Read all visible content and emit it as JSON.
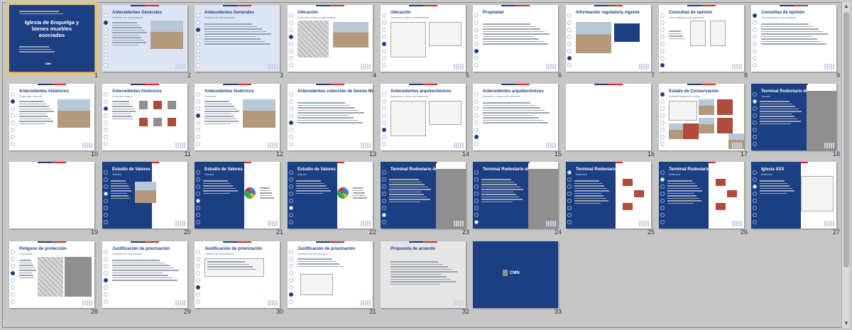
{
  "window": {
    "name": "slide-sorter"
  },
  "slides": [
    {
      "n": "1",
      "kind": "cover",
      "title": "Iglesia de Enquelga y bienes muebles asociados",
      "logo": "CMN"
    },
    {
      "n": "2",
      "kind": "text-photo",
      "title": "Antecedentes Generales",
      "sub": "Solicitud de declaratoria",
      "bg": "light-blue"
    },
    {
      "n": "3",
      "kind": "text",
      "title": "Antecedentes Generales",
      "sub": "Solicitud de declaratoria",
      "bg": "light-blue"
    },
    {
      "n": "4",
      "kind": "map",
      "title": "Ubicación",
      "sub": "Contexto urbano y patrimonial"
    },
    {
      "n": "5",
      "kind": "plans",
      "title": "Ubicación",
      "sub": "Contexto urbano y patrimonial"
    },
    {
      "n": "6",
      "kind": "text",
      "title": "Propiedad",
      "sub": ""
    },
    {
      "n": "7",
      "kind": "photo-panel",
      "title": "Información regulatoria vigente",
      "sub": ""
    },
    {
      "n": "8",
      "kind": "docs",
      "title": "Consultas de opinión",
      "sub": "Comunidades y propietarios"
    },
    {
      "n": "9",
      "kind": "text",
      "title": "Consultas de opinión",
      "sub": "Comunidades y propietarios"
    },
    {
      "n": "10",
      "kind": "text-photo",
      "title": "Antecedentes históricos",
      "sub": "Enquelga, historia"
    },
    {
      "n": "11",
      "kind": "timeline",
      "title": "Antecedentes históricos",
      "sub": "Línea de tiempo"
    },
    {
      "n": "12",
      "kind": "text-photo",
      "title": "Antecedentes históricos",
      "sub": "Contexto"
    },
    {
      "n": "13",
      "kind": "text",
      "title": "Antecedentes colección de bienes Muebles",
      "sub": ""
    },
    {
      "n": "14",
      "kind": "plans",
      "title": "Antecedentes arquitectónicos",
      "sub": "Aspectos y usos del inmueble"
    },
    {
      "n": "15",
      "kind": "text",
      "title": "Antecedentes arquitectónicos",
      "sub": "Aspectos y usos del inmueble"
    },
    {
      "n": "16",
      "kind": "blank",
      "title": "",
      "sub": ""
    },
    {
      "n": "17",
      "kind": "collage",
      "title": "Estado de Conservación",
      "sub": "Análisis inspección visita"
    },
    {
      "n": "18",
      "kind": "dark-photo",
      "title": "Terminal Rodoviario de",
      "sub": "Valores"
    },
    {
      "n": "19",
      "kind": "blank",
      "title": "",
      "sub": ""
    },
    {
      "n": "20",
      "kind": "dark-photo-small",
      "title": "Estudio de Valores",
      "sub": "Valores"
    },
    {
      "n": "21",
      "kind": "dark-pie",
      "title": "Estudio de Valores",
      "sub": "Valores"
    },
    {
      "n": "22",
      "kind": "dark-pie",
      "title": "Estudio de Valores",
      "sub": "Valores"
    },
    {
      "n": "23",
      "kind": "dark-photo",
      "title": "Terminal Rodoviario de Arica",
      "sub": ""
    },
    {
      "n": "24",
      "kind": "dark-photo",
      "title": "Terminal Rodoviario de",
      "sub": ""
    },
    {
      "n": "25",
      "kind": "dark-iso",
      "title": "Terminal Rodoviario de",
      "sub": "Atributos"
    },
    {
      "n": "26",
      "kind": "dark-iso",
      "title": "Terminal Rodoviario de",
      "sub": "Atributos"
    },
    {
      "n": "27",
      "kind": "dark-plan",
      "title": "Iglesia XXX",
      "sub": "Atributos"
    },
    {
      "n": "28",
      "kind": "map-photo",
      "title": "Polígono de protección",
      "sub": "Propuesta"
    },
    {
      "n": "29",
      "kind": "text",
      "title": "Justificación de priorización",
      "sub": "Criterios de priorización"
    },
    {
      "n": "30",
      "kind": "box",
      "title": "Justificación de priorización",
      "sub": "Criterios de priorización"
    },
    {
      "n": "31",
      "kind": "doc-small",
      "title": "Justificación de priorización",
      "sub": "Criterios de priorización"
    },
    {
      "n": "32",
      "kind": "grey-text",
      "title": "Propuesta de acuerdo",
      "sub": ""
    },
    {
      "n": "33",
      "kind": "end",
      "title": "",
      "sub": "",
      "logo": "CMN"
    }
  ]
}
